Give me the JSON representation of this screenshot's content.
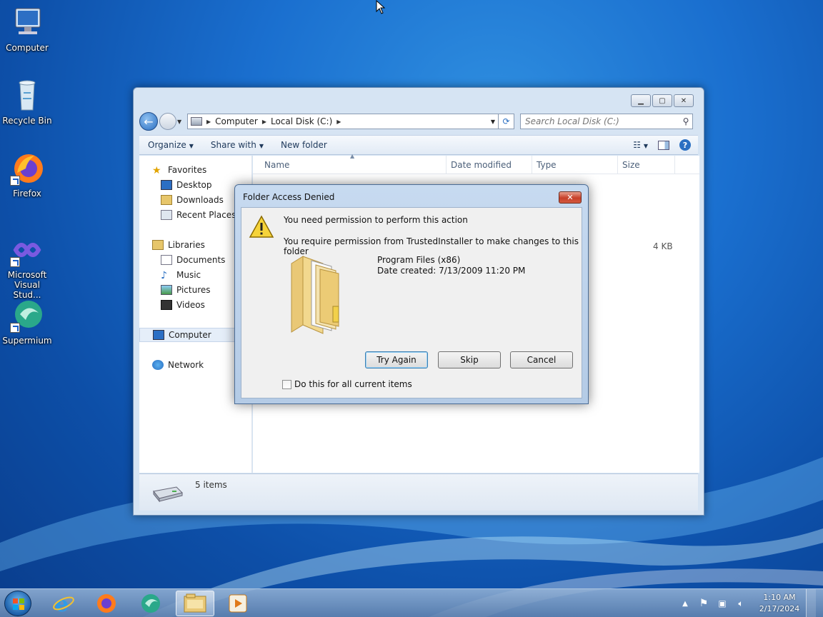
{
  "desktop": {
    "icons": [
      {
        "label": "Computer"
      },
      {
        "label": "Recycle Bin"
      },
      {
        "label": "Firefox"
      },
      {
        "label": "Microsoft Visual Stud..."
      },
      {
        "label": "Supermium"
      }
    ]
  },
  "explorer": {
    "address": {
      "crumbs": [
        "Computer",
        "Local Disk (C:)"
      ]
    },
    "search": {
      "placeholder": "Search Local Disk (C:)"
    },
    "toolbar": {
      "organize": "Organize",
      "share_with": "Share with",
      "new_folder": "New folder"
    },
    "nav": {
      "favorites": "Favorites",
      "desktop": "Desktop",
      "downloads": "Downloads",
      "recent_places": "Recent Places",
      "libraries": "Libraries",
      "documents": "Documents",
      "music": "Music",
      "pictures": "Pictures",
      "videos": "Videos",
      "computer": "Computer",
      "network": "Network"
    },
    "columns": {
      "name": "Name",
      "date_modified": "Date modified",
      "type": "Type",
      "size": "Size"
    },
    "visible_size": "4 KB",
    "status": {
      "items": "5 items"
    }
  },
  "dialog": {
    "title": "Folder Access Denied",
    "heading": "You need permission to perform this action",
    "message": "You require permission from TrustedInstaller to make changes to this folder",
    "item_name": "Program Files (x86)",
    "item_date": "Date created: 7/13/2009 11:20 PM",
    "buttons": {
      "try_again": "Try Again",
      "skip": "Skip",
      "cancel": "Cancel"
    },
    "checkbox_label": "Do this for all current items",
    "checkbox_checked": false
  },
  "taskbar": {
    "apps": [
      "internet-explorer",
      "firefox",
      "supermium",
      "windows-explorer",
      "media-player"
    ],
    "active_app": "windows-explorer",
    "clock": {
      "time": "1:10 AM",
      "date": "2/17/2024"
    }
  }
}
